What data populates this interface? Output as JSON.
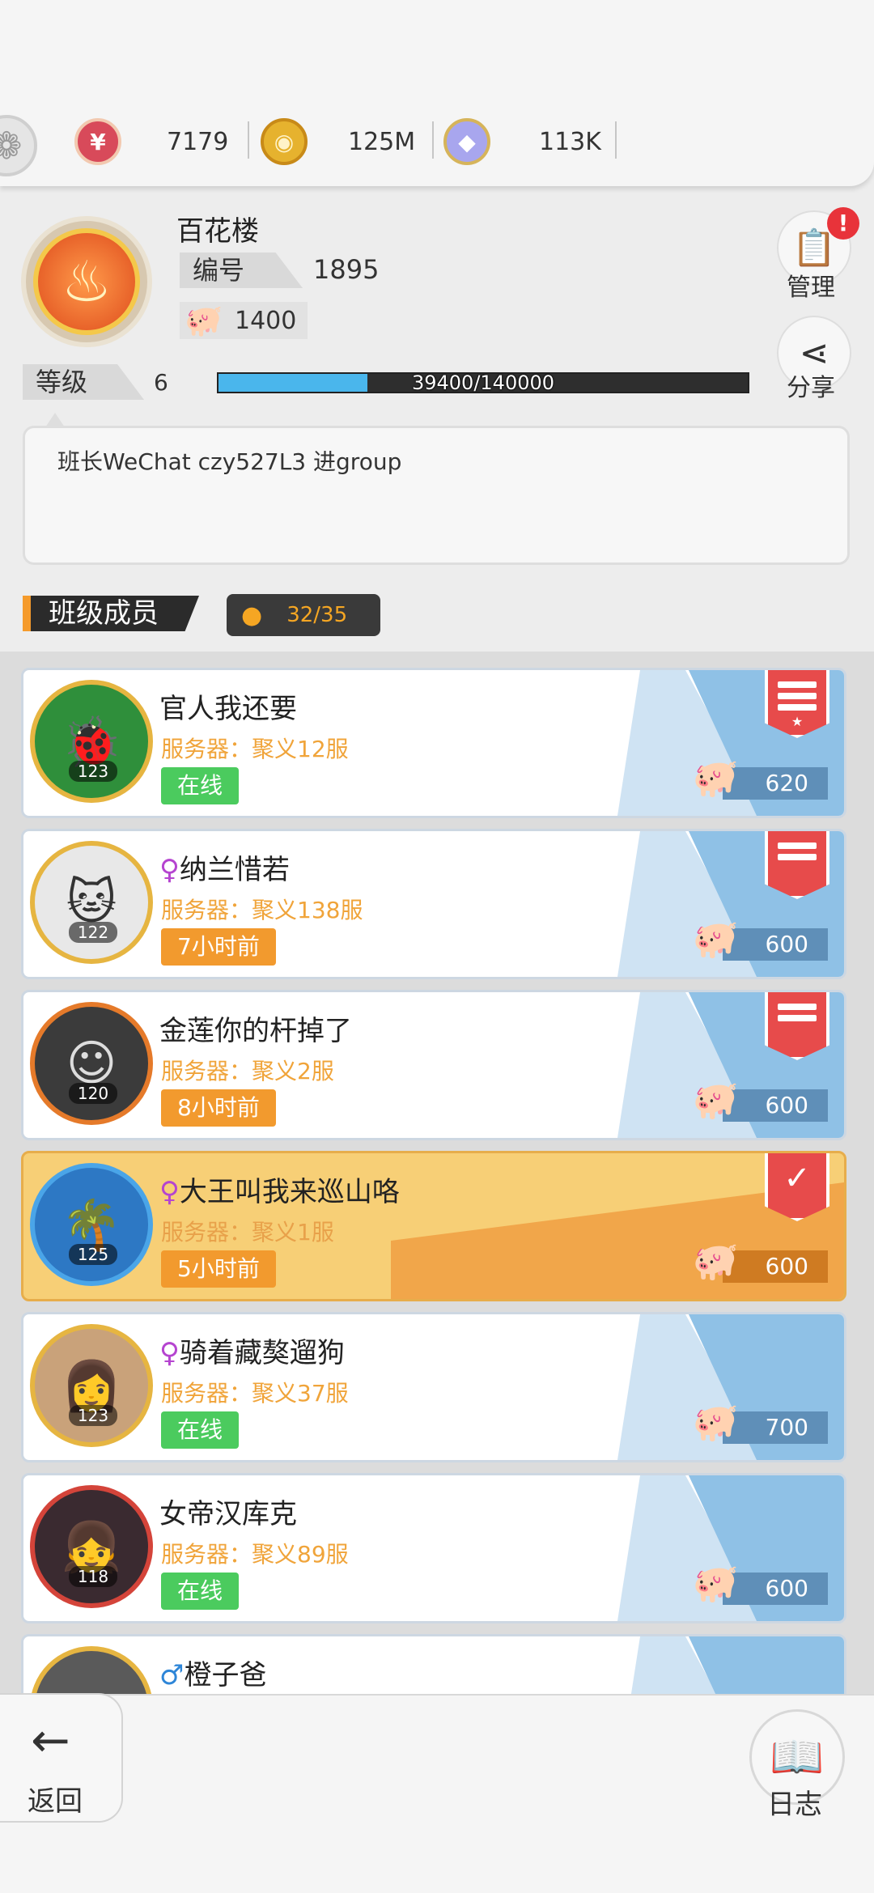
{
  "currencies": [
    {
      "name": "token",
      "icon": "red-token-icon",
      "value": "7179",
      "color": "#d84a5a"
    },
    {
      "name": "gold",
      "icon": "gold-coin-icon",
      "value": "125M",
      "color": "#e6b22e"
    },
    {
      "name": "gem",
      "icon": "gem-ring-icon",
      "value": "113K",
      "color": "#7d7ad6"
    }
  ],
  "class_info": {
    "name": "百花楼",
    "id_label": "编号",
    "id_value": "1895",
    "funds": "1400",
    "level_label": "等级",
    "level": "6",
    "xp_text": "39400/140000",
    "xp_fraction": 0.2814
  },
  "side_buttons": {
    "manage_label": "管理",
    "share_label": "分享",
    "badge": "!"
  },
  "notice": "班长WeChat   czy527L3 进group",
  "members_section": {
    "title": "班级成员",
    "count": "32/35"
  },
  "members": [
    {
      "name": "官人我还要",
      "gender": "",
      "server": "服务器：聚义12服",
      "status": "在线",
      "status_type": "online",
      "level": "123",
      "contribution": "620",
      "rank": "monitor"
    },
    {
      "name": "纳兰惜若",
      "gender": "♀",
      "server": "服务器：聚义138服",
      "status": "7小时前",
      "status_type": "offline",
      "level": "122",
      "contribution": "600",
      "rank": "vice"
    },
    {
      "name": "金莲你的杆掉了",
      "gender": "",
      "server": "服务器：聚义2服",
      "status": "8小时前",
      "status_type": "offline",
      "level": "120",
      "contribution": "600",
      "rank": "vice"
    },
    {
      "name": "大王叫我来巡山咯",
      "gender": "♀",
      "server": "服务器：聚义1服",
      "status": "5小时前",
      "status_type": "offline",
      "level": "125",
      "contribution": "600",
      "rank": "elite"
    },
    {
      "name": "骑着藏獒遛狗",
      "gender": "♀",
      "server": "服务器：聚义37服",
      "status": "在线",
      "status_type": "online",
      "level": "123",
      "contribution": "700",
      "rank": ""
    },
    {
      "name": "女帝汉库克",
      "gender": "",
      "server": "服务器：聚义89服",
      "status": "在线",
      "status_type": "online",
      "level": "118",
      "contribution": "600",
      "rank": ""
    },
    {
      "name": "橙子爸",
      "gender": "♂",
      "server": "",
      "status": "",
      "status_type": "",
      "level": "",
      "contribution": "",
      "rank": ""
    }
  ],
  "bottom": {
    "back_label": "返回",
    "log_label": "日志"
  }
}
